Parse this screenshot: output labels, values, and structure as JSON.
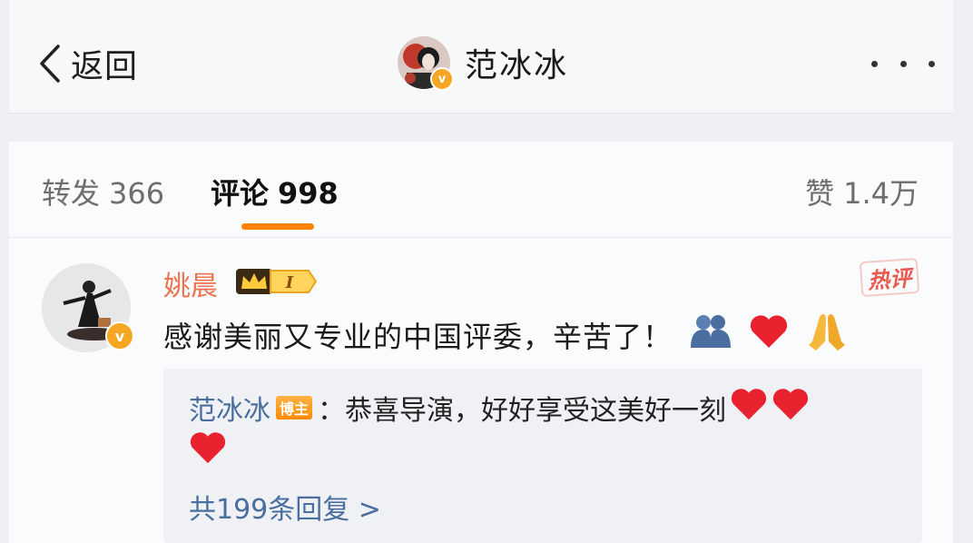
{
  "header": {
    "back_label": "返回",
    "title": "范冰冰",
    "verified_badge": "v",
    "more_icon": "more-horizontal-icon"
  },
  "tabs": {
    "repost_label": "转发",
    "repost_count": "366",
    "comment_label": "评论",
    "comment_count": "998",
    "likes_label": "赞",
    "likes_count": "1.4万",
    "accent_color": "#ff8200"
  },
  "comment": {
    "author": "姚晨",
    "verified_badge": "v",
    "level_badge": "I",
    "hot_label": "热评",
    "text": "感谢美丽又专业的中国评委，辛苦了！",
    "emojis": [
      "hug-icon",
      "red-heart-icon",
      "pray-icon"
    ],
    "reply": {
      "author": "范冰冰",
      "tag": "博主",
      "text": "：恭喜导演，好好享受这美好一刻",
      "more_replies": "共199条回复 >"
    }
  }
}
